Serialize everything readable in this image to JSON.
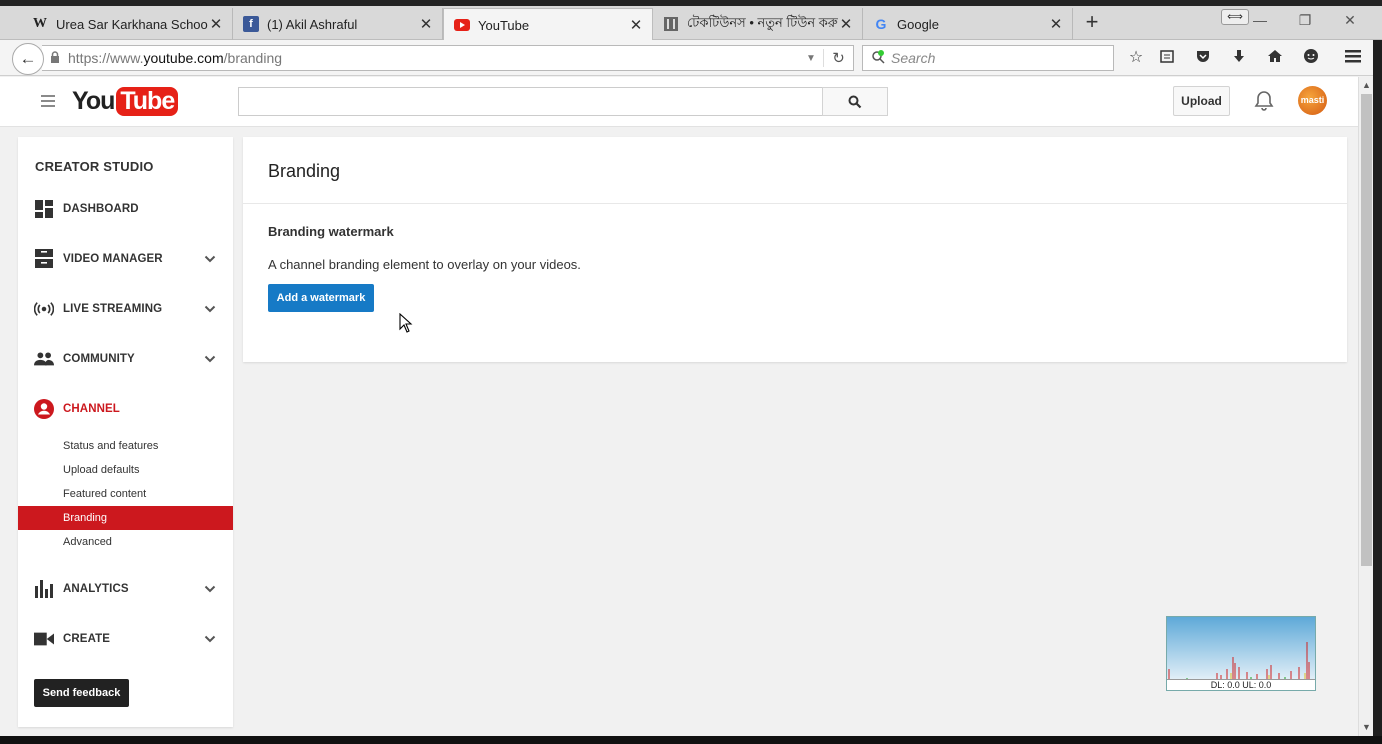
{
  "browser": {
    "tabs": [
      {
        "label": "Urea Sar Karkhana School ...",
        "icon": "wikipedia-icon",
        "active": false
      },
      {
        "label": "(1) Akil Ashraful",
        "icon": "facebook-icon",
        "active": false
      },
      {
        "label": "YouTube",
        "icon": "youtube-icon",
        "active": true
      },
      {
        "label": "টেকটিউনস • নতুন টিউন করুন",
        "icon": "techtunes-icon",
        "active": false
      },
      {
        "label": "Google",
        "icon": "google-icon",
        "active": false
      }
    ],
    "url_prefix": "https://www.",
    "url_domain": "youtube.com",
    "url_path": "/branding",
    "search_placeholder": "Search"
  },
  "masthead": {
    "logo_you": "You",
    "logo_tube": "Tube",
    "upload_label": "Upload",
    "avatar_text": "masti"
  },
  "sidebar": {
    "title": "CREATOR STUDIO",
    "items": [
      {
        "label": "DASHBOARD",
        "icon": "dashboard-icon",
        "expandable": false
      },
      {
        "label": "VIDEO MANAGER",
        "icon": "video-manager-icon",
        "expandable": true
      },
      {
        "label": "LIVE STREAMING",
        "icon": "live-streaming-icon",
        "expandable": true
      },
      {
        "label": "COMMUNITY",
        "icon": "community-icon",
        "expandable": true
      },
      {
        "label": "CHANNEL",
        "icon": "channel-icon",
        "expandable": false
      },
      {
        "label": "ANALYTICS",
        "icon": "analytics-icon",
        "expandable": true
      },
      {
        "label": "CREATE",
        "icon": "create-icon",
        "expandable": true
      }
    ],
    "channel_subitems": [
      {
        "label": "Status and features",
        "active": false
      },
      {
        "label": "Upload defaults",
        "active": false
      },
      {
        "label": "Featured content",
        "active": false
      },
      {
        "label": "Branding",
        "active": true
      },
      {
        "label": "Advanced",
        "active": false
      }
    ],
    "feedback_label": "Send feedback"
  },
  "main": {
    "title": "Branding",
    "section_title": "Branding watermark",
    "section_desc": "A channel branding element to overlay on your videos.",
    "watermark_button": "Add a watermark"
  },
  "netmon": {
    "label": "DL: 0.0 UL: 0.0"
  },
  "colors": {
    "accent_red": "#cc181e",
    "button_blue": "#167ac6"
  }
}
